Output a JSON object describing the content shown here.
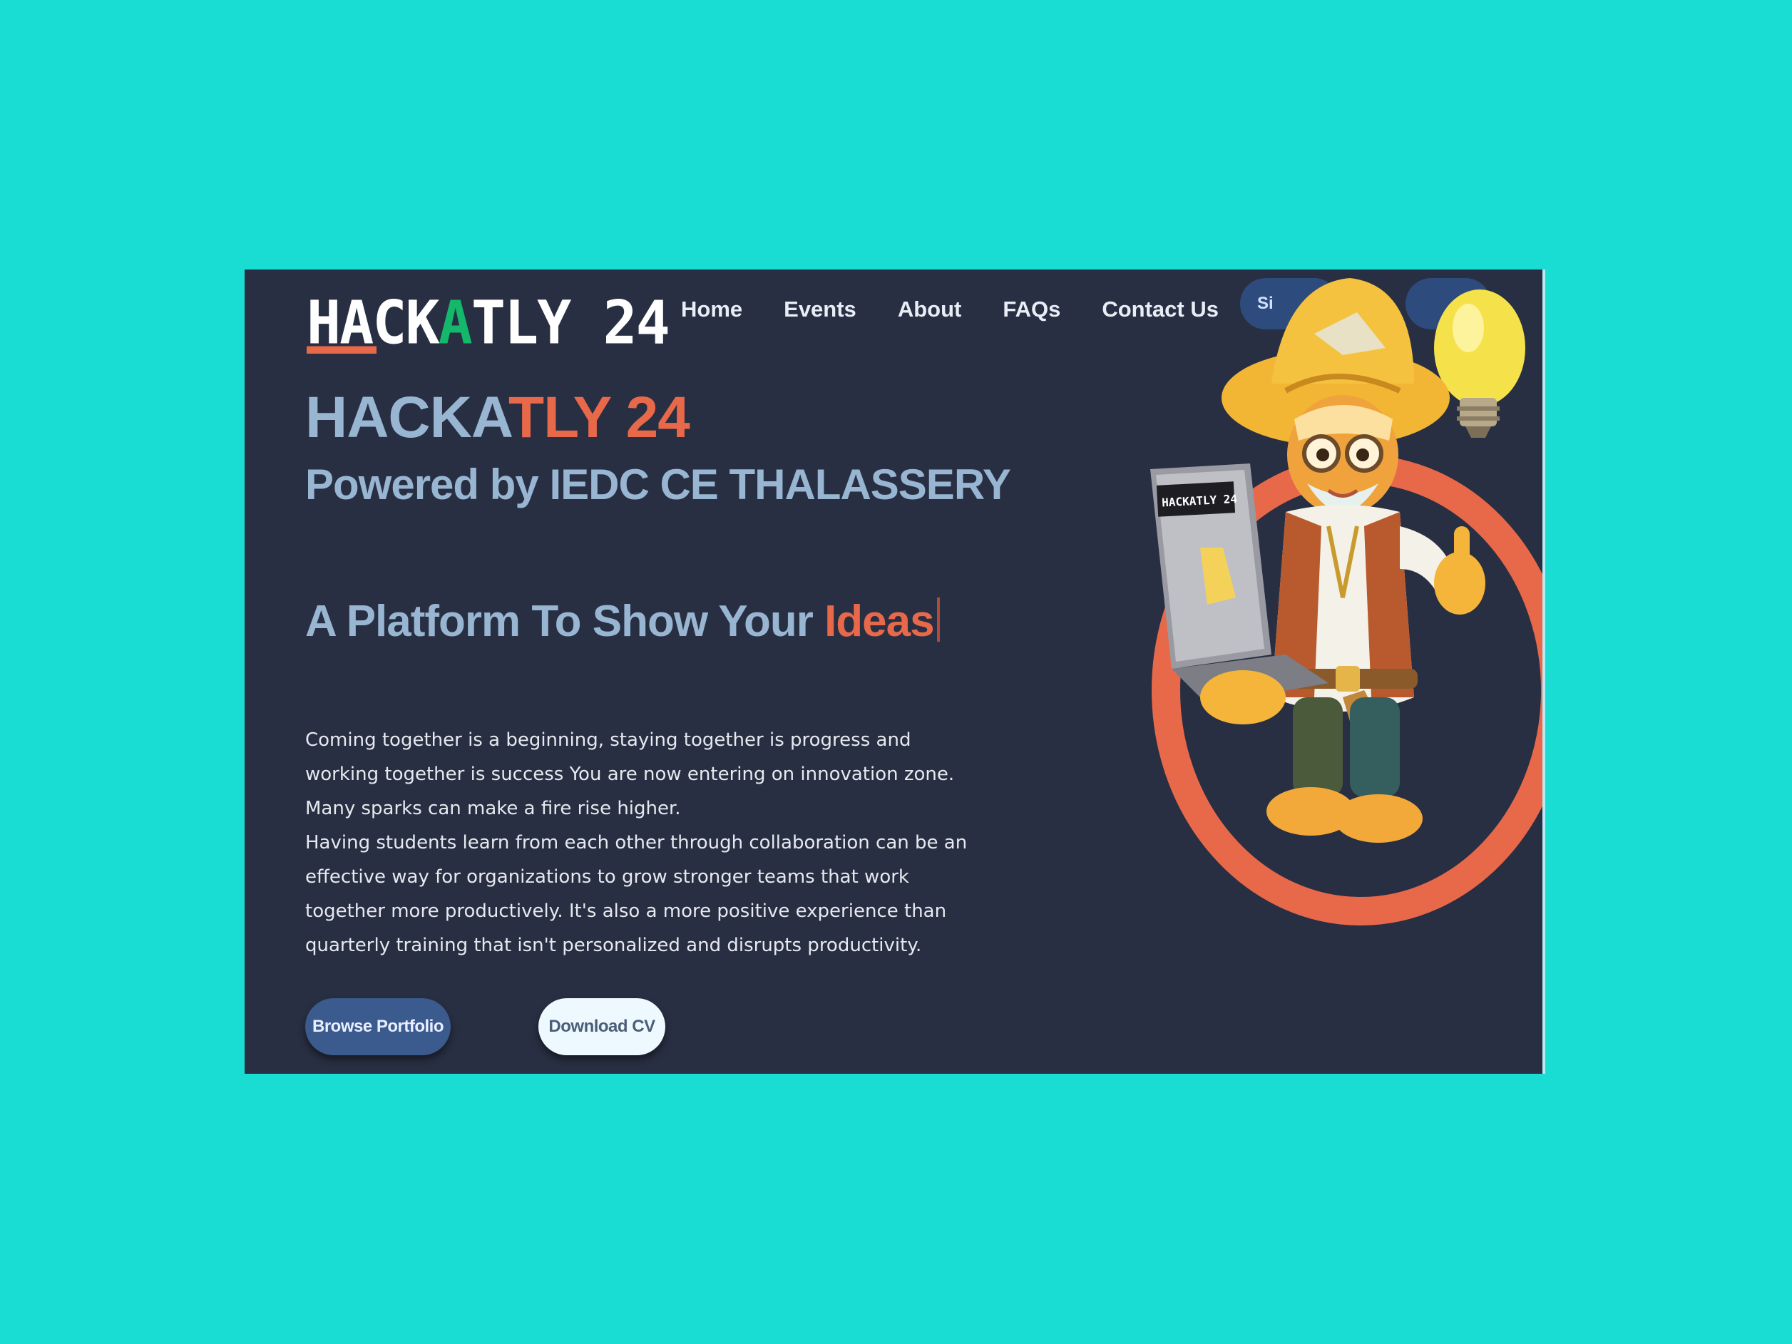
{
  "nav": {
    "logo": {
      "part1": "HACK",
      "part2": "A",
      "part3": "TLY 24"
    },
    "links": [
      "Home",
      "Events",
      "About",
      "FAQs",
      "Contact Us"
    ],
    "signin_partial": "Si"
  },
  "hero": {
    "title_part1": "HACKA",
    "title_part2": "TLY 24",
    "subtitle": "Powered by IEDC CE THALASSERY",
    "tagline_prefix": "A Platform To Show Your ",
    "tagline_highlight": "Ideas",
    "paragraph1": "Coming together is a beginning, staying together is progress and working together is success You are now entering on innovation zone. Many sparks can make a fire rise higher.",
    "paragraph2": "Having students learn from each other through collaboration can be an effective way for organizations to grow stronger teams that work together more productively. It's also a more positive experience than quarterly training that isn't personalized and disrupts productivity."
  },
  "buttons": {
    "browse": "Browse Portfolio",
    "download": "Download CV"
  },
  "illustration": {
    "laptop_sticker": "HACKATLY 24"
  },
  "colors": {
    "page_background": "#19ddd3",
    "site_background": "#282f42",
    "accent": "#e8684a",
    "title": "#98b5d2",
    "logo_green": "#14b86a",
    "button_blue": "#3b5a8e"
  }
}
